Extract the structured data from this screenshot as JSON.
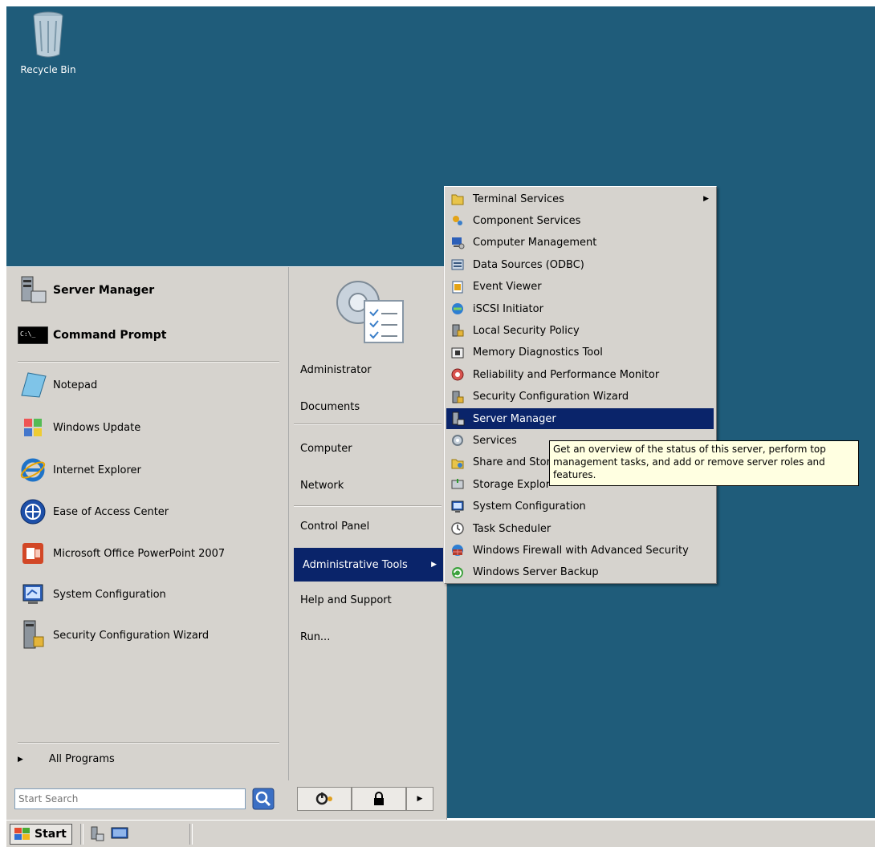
{
  "desktop": {
    "recycle_bin_label": "Recycle Bin"
  },
  "start_menu": {
    "pinned": [
      {
        "label": "Server Manager",
        "icon": "server-manager-icon"
      },
      {
        "label": "Command Prompt",
        "icon": "command-prompt-icon"
      }
    ],
    "recent": [
      {
        "label": "Notepad",
        "icon": "notepad-icon"
      },
      {
        "label": "Windows Update",
        "icon": "windows-update-icon"
      },
      {
        "label": "Internet Explorer",
        "icon": "internet-explorer-icon"
      },
      {
        "label": "Ease of Access Center",
        "icon": "ease-of-access-icon"
      },
      {
        "label": "Microsoft Office PowerPoint 2007",
        "icon": "powerpoint-icon"
      },
      {
        "label": "System Configuration",
        "icon": "system-configuration-icon"
      },
      {
        "label": "Security Configuration Wizard",
        "icon": "security-wizard-icon"
      }
    ],
    "all_programs": "All Programs",
    "search_placeholder": "Start Search",
    "right": {
      "administrator": "Administrator",
      "documents": "Documents",
      "computer": "Computer",
      "network": "Network",
      "control_panel": "Control Panel",
      "administrative_tools": "Administrative Tools",
      "help_and_support": "Help and Support",
      "run": "Run..."
    }
  },
  "admin_tools": [
    {
      "label": "Terminal Services",
      "icon": "folder-icon",
      "submenu": true
    },
    {
      "label": "Component Services",
      "icon": "component-services-icon"
    },
    {
      "label": "Computer Management",
      "icon": "computer-management-icon"
    },
    {
      "label": "Data Sources (ODBC)",
      "icon": "odbc-icon"
    },
    {
      "label": "Event Viewer",
      "icon": "event-viewer-icon"
    },
    {
      "label": "iSCSI Initiator",
      "icon": "iscsi-icon"
    },
    {
      "label": "Local Security Policy",
      "icon": "security-policy-icon"
    },
    {
      "label": "Memory Diagnostics Tool",
      "icon": "memory-diagnostics-icon"
    },
    {
      "label": "Reliability and Performance Monitor",
      "icon": "performance-monitor-icon"
    },
    {
      "label": "Security Configuration Wizard",
      "icon": "security-wizard-icon"
    },
    {
      "label": "Server Manager",
      "icon": "server-manager-icon",
      "highlighted": true
    },
    {
      "label": "Services",
      "icon": "services-icon"
    },
    {
      "label": "Share and Stor",
      "icon": "share-storage-icon"
    },
    {
      "label": "Storage Explor",
      "icon": "storage-explorer-icon"
    },
    {
      "label": "System Configuration",
      "icon": "system-configuration-icon"
    },
    {
      "label": "Task Scheduler",
      "icon": "task-scheduler-icon"
    },
    {
      "label": "Windows Firewall with Advanced Security",
      "icon": "firewall-icon"
    },
    {
      "label": "Windows Server Backup",
      "icon": "server-backup-icon"
    }
  ],
  "tooltip": {
    "line1": "Get an overview of the status of this server, perform top",
    "line2": "management tasks, and add or remove server roles and",
    "line3": "features."
  },
  "taskbar": {
    "start_label": "Start"
  },
  "colors": {
    "desktop": "#1f5c7a",
    "menu": "#d6d3ce",
    "highlight": "#0a246a",
    "tooltip": "#ffffe1"
  }
}
